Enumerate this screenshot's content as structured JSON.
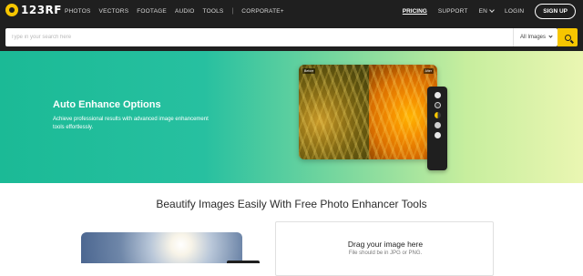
{
  "topnav": {
    "logo_text": "123RF",
    "links": [
      "PHOTOS",
      "VECTORS",
      "FOOTAGE",
      "AUDIO",
      "TOOLS"
    ],
    "separator": "|",
    "corporate": "CORPORATE+",
    "pricing": "PRICING",
    "support": "SUPPORT",
    "language": "EN",
    "login": "LOGIN",
    "signup": "SIGN UP"
  },
  "search": {
    "placeholder": "Type in your search here",
    "filter_value": "All Images"
  },
  "hero": {
    "title": "Auto Enhance Options",
    "description": "Achieve professional results with advanced image enhancement tools effortlessly.",
    "before_tag": "Before",
    "after_tag": "After"
  },
  "section": {
    "title": "Beautify Images Easily With Free Photo Enhancer Tools"
  },
  "upload": {
    "title": "Drag your image here",
    "subtitle": "File should be in JPG or PNG."
  },
  "colors": {
    "nav_bg": "#1f1f1f",
    "accent_yellow": "#f7c600",
    "hero_green": "#1bba96"
  }
}
